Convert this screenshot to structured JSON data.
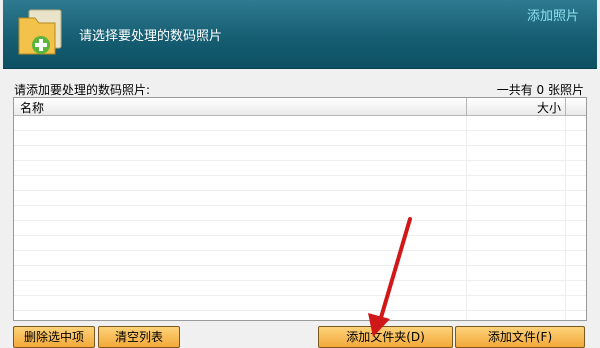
{
  "banner": {
    "title": "请选择要处理的数码照片",
    "link": "添加照片"
  },
  "list": {
    "label": "请添加要处理的数码照片:",
    "count": "一共有 0 张照片",
    "columns": {
      "name": "名称",
      "size": "大小"
    },
    "rows": []
  },
  "buttons": {
    "delete_selected": "删除选中项",
    "clear_list": "清空列表",
    "add_folder": "添加文件夹(D)",
    "add_file": "添加文件(F)"
  },
  "colors": {
    "banner": "#165e72",
    "button": "#f3a93a",
    "arrow": "#d01818"
  },
  "icons": {
    "banner_icon": "folder-add-icon",
    "arrow": "red-arrow-annotation"
  }
}
